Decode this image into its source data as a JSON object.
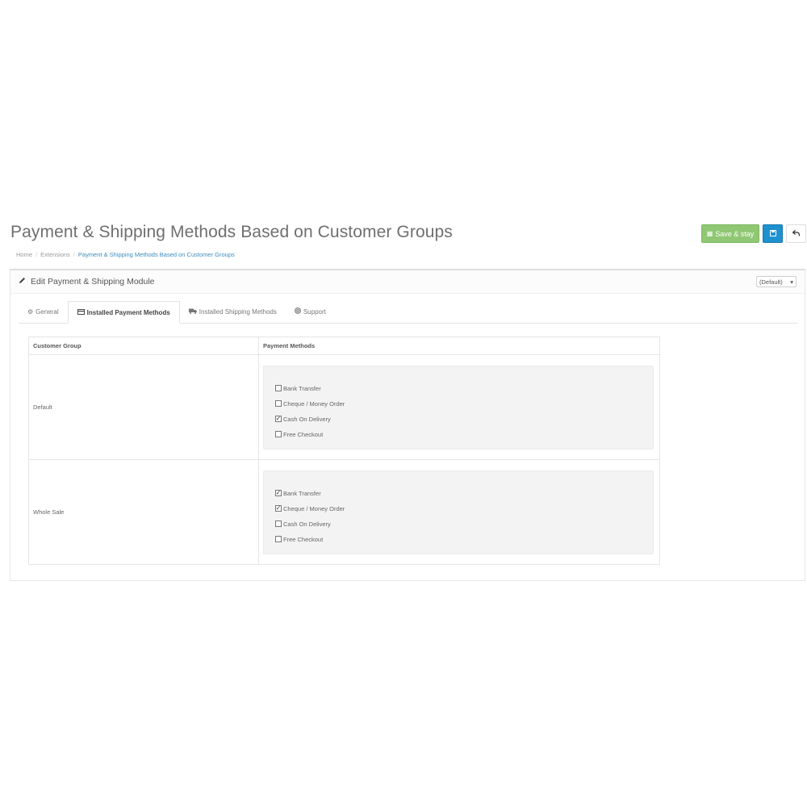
{
  "page": {
    "title": "Payment & Shipping Methods Based on Customer Groups"
  },
  "actions": {
    "save_stay_label": "Save & stay",
    "save_icon": "save-icon",
    "back_icon": "reply-icon"
  },
  "breadcrumb": {
    "items": [
      "Home",
      "Extensions",
      "Payment & Shipping Methods Based on Customer Groups"
    ]
  },
  "panel": {
    "title": "Edit Payment & Shipping Module",
    "store_select": "(Default)"
  },
  "tabs": [
    {
      "label": "General",
      "icon": "cogs-icon",
      "active": false
    },
    {
      "label": "Installed Payment Methods",
      "icon": "credit-card-icon",
      "active": true
    },
    {
      "label": "Installed Shipping Methods",
      "icon": "truck-icon",
      "active": false
    },
    {
      "label": "Support",
      "icon": "support-icon",
      "active": false
    }
  ],
  "table": {
    "headers": [
      "Customer Group",
      "Payment Methods"
    ],
    "rows": [
      {
        "group": "Default",
        "methods": [
          {
            "label": "Bank Transfer",
            "checked": false
          },
          {
            "label": "Cheque / Money Order",
            "checked": false
          },
          {
            "label": "Cash On Delivery",
            "checked": true
          },
          {
            "label": "Free Checkout",
            "checked": false
          }
        ]
      },
      {
        "group": "Whole Sale",
        "methods": [
          {
            "label": "Bank Transfer",
            "checked": true
          },
          {
            "label": "Cheque / Money Order",
            "checked": true
          },
          {
            "label": "Cash On Delivery",
            "checked": false
          },
          {
            "label": "Free Checkout",
            "checked": false
          }
        ]
      }
    ]
  },
  "colors": {
    "accent": "#1e91cf",
    "success": "#8fc773",
    "link": "#3b8dbd"
  }
}
